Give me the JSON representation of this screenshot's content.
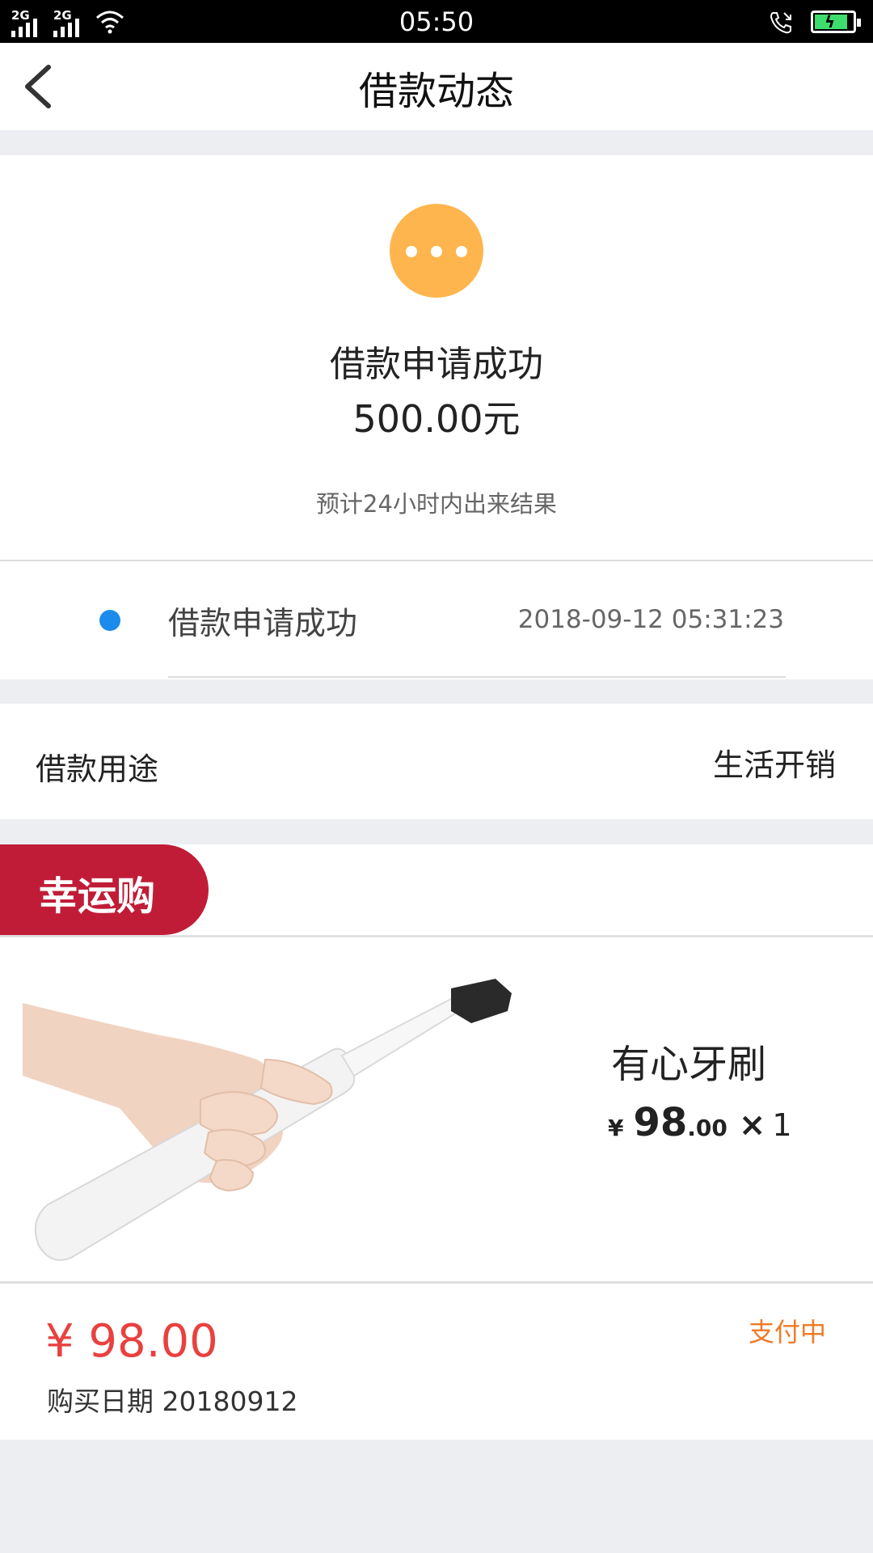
{
  "status_bar": {
    "sim1": "2G",
    "sim2": "2G",
    "time": "05:50",
    "battery_color": "#3ddc6c"
  },
  "header": {
    "title": "借款动态",
    "back_icon": "chevron-left-icon"
  },
  "status_card": {
    "icon": "more-dots-icon",
    "icon_color": "#ffb54d",
    "title": "借款申请成功",
    "amount": "500.00元",
    "hint": "预计24小时内出来结果"
  },
  "timeline": [
    {
      "label": "借款申请成功",
      "time": "2018-09-12 05:31:23",
      "dot_color": "#1b8ceb"
    }
  ],
  "purpose": {
    "label": "借款用途",
    "value": "生活开销"
  },
  "lucky_buy": {
    "tag": "幸运购",
    "tag_color": "#c11c37",
    "product": {
      "name": "有心牙刷",
      "currency": "¥",
      "price_int": "98",
      "price_dec": ".00",
      "multiply": "×",
      "quantity": "1",
      "image_icon": "electric-toothbrush-image"
    },
    "order": {
      "total": "¥ 98.00",
      "status": "支付中",
      "status_color": "#f07a26",
      "date": "购买日期 20180912"
    }
  }
}
